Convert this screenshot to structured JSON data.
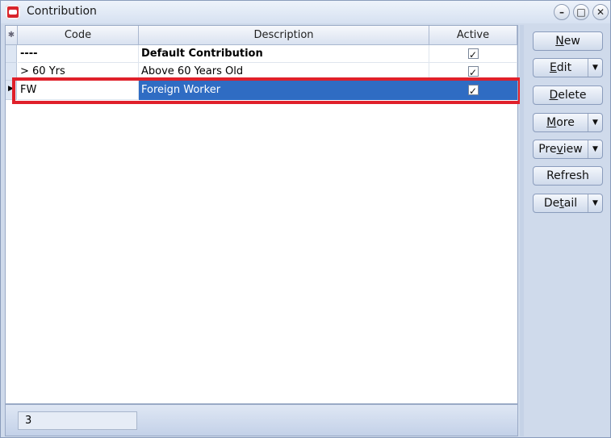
{
  "window": {
    "title": "Contribution",
    "min": "–",
    "max": "□",
    "close": "✕"
  },
  "grid": {
    "columns": [
      "Code",
      "Description",
      "Active"
    ],
    "header_icon": "✱",
    "rows": [
      {
        "code": "----",
        "description": "Default Contribution",
        "active": true
      },
      {
        "code": "> 60 Yrs",
        "description": "Above 60 Years Old",
        "active": true
      },
      {
        "code": "FW",
        "description": "Foreign Worker",
        "active": true
      }
    ]
  },
  "footer": {
    "count": "3"
  },
  "actions": {
    "new": {
      "pre": "",
      "key": "N",
      "post": "ew"
    },
    "edit": {
      "pre": "",
      "key": "E",
      "post": "dit"
    },
    "delete": {
      "pre": "",
      "key": "D",
      "post": "elete"
    },
    "more": {
      "pre": "",
      "key": "M",
      "post": "ore"
    },
    "preview": {
      "pre": "Pre",
      "key": "v",
      "post": "iew"
    },
    "refresh": {
      "pre": "",
      "key": "",
      "post": "Refresh"
    },
    "detail": {
      "pre": "De",
      "key": "t",
      "post": "ail"
    },
    "dropdown_glyph": "▼"
  },
  "colors": {
    "selection": "#2f6cc3",
    "highlight_border": "#e0202a"
  }
}
